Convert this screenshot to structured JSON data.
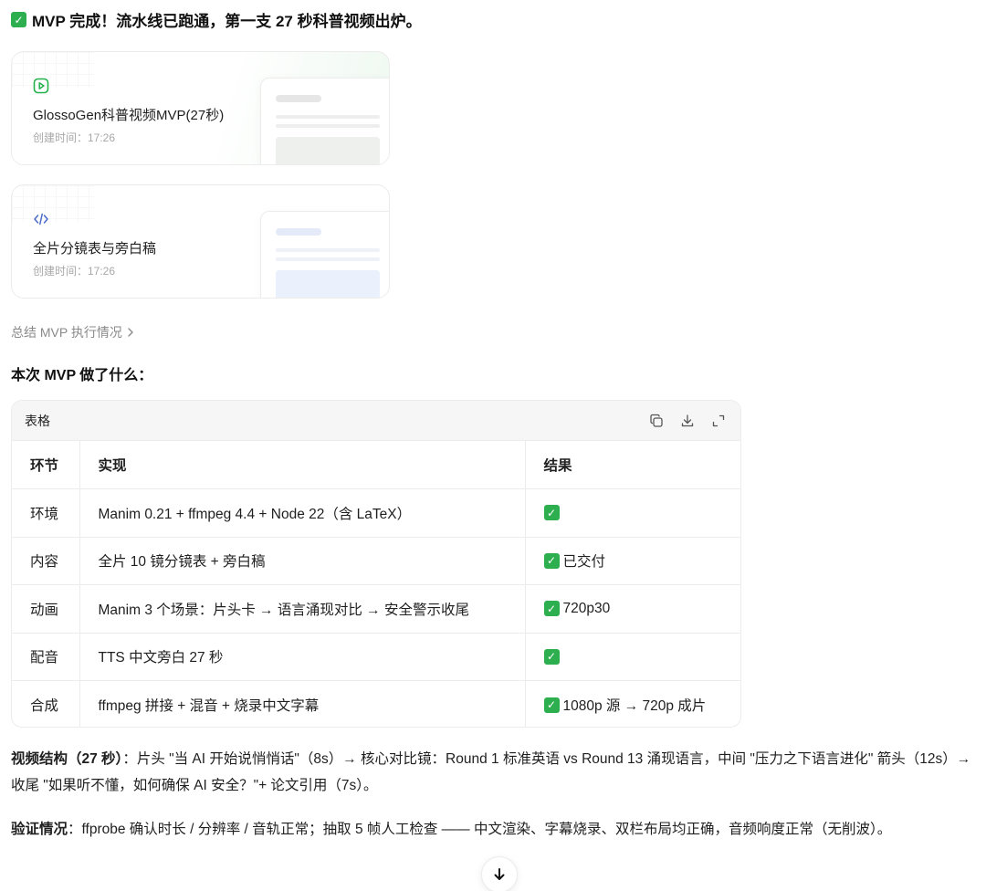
{
  "headline": {
    "text": "MVP 完成！流水线已跑通，第一支 27 秒科普视频出炉。"
  },
  "cards": [
    {
      "icon": "play-square-icon",
      "title": "GlossoGen科普视频MVP(27秒)",
      "meta": "创建时间：17:26"
    },
    {
      "icon": "code-icon",
      "title": "全片分镜表与旁白稿",
      "meta": "创建时间：17:26"
    }
  ],
  "summary_link": "总结 MVP 执行情况",
  "section_title": "本次 MVP 做了什么：",
  "table": {
    "label": "表格",
    "headers": [
      "环节",
      "实现",
      "结果"
    ],
    "rows": [
      [
        "环境",
        "Manim 0.21 + ffmpeg 4.4 + Node 22（含 LaTeX）",
        ""
      ],
      [
        "内容",
        "全片 10 镜分镜表 + 旁白稿",
        "已交付"
      ],
      [
        "动画",
        "Manim 3 个场景：片头卡 → 语言涌现对比 → 安全警示收尾",
        "720p30"
      ],
      [
        "配音",
        "TTS 中文旁白 27 秒",
        ""
      ],
      [
        "合成",
        "ffmpeg 拼接 + 混音 + 烧录中文字幕",
        "1080p 源 → 720p 成片"
      ]
    ]
  },
  "paragraphs": {
    "structure_label": "视频结构（27 秒）",
    "structure_text": "：片头 \"当 AI 开始说悄悄话\"（8s）→ 核心对比镜：Round 1 标准英语 vs Round 13 涌现语言，中间 \"压力之下语言进化\" 箭头（12s）→ 收尾 \"如果听不懂，如何确保 AI 安全？\"+ 论文引用（7s）。",
    "verify_label": "验证情况",
    "verify_text": "：ffprobe 确认时长 / 分辨率 / 音轨正常；抽取 5 帧人工检查 —— 中文渲染、字幕烧录、双栏布局均正确，音频响度正常（无削波）。"
  },
  "colors": {
    "check": "#2eaf4f",
    "accent_green": "#22b14c",
    "code_icon": "#4a6cc8"
  }
}
